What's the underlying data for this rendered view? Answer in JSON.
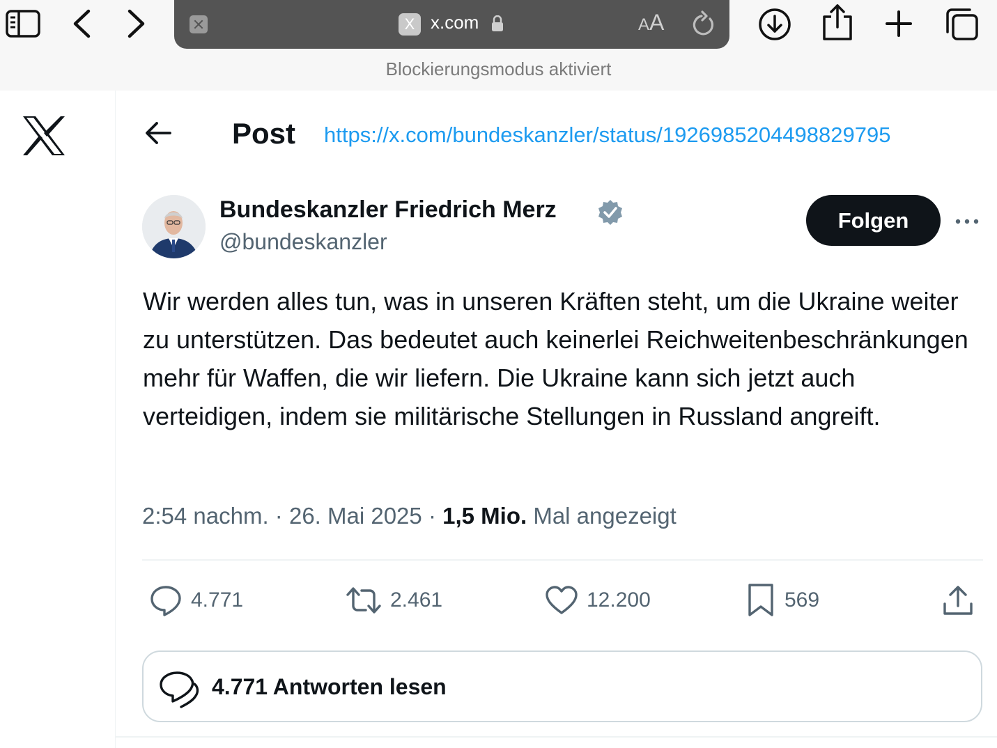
{
  "browser": {
    "domain": "x.com",
    "favicon_letter": "X",
    "text_size_label_small": "A",
    "text_size_label_big": "A",
    "status": "Blockierungsmodus aktiviert"
  },
  "header": {
    "title": "Post",
    "url": "https://x.com/bundeskanzler/status/1926985204498829795"
  },
  "author": {
    "name": "Bundeskanzler Friedrich Merz",
    "handle": "@bundeskanzler",
    "follow_label": "Folgen"
  },
  "post": {
    "text": "Wir werden alles tun, was in unseren Kräften steht, um die Ukraine weiter zu unterstützen. Das bedeutet auch keinerlei Reichweitenbeschränkungen mehr für Waffen, die wir liefern. Die Ukraine kann sich jetzt auch verteidigen, indem sie militärische Stellungen in Russland angreift.",
    "time": "2:54 nachm.",
    "separator": "·",
    "date": "26. Mai 2025",
    "views_count": "1,5 Mio.",
    "views_label": "Mal angezeigt"
  },
  "actions": {
    "replies": "4.771",
    "reposts": "2.461",
    "likes": "12.200",
    "bookmarks": "569"
  },
  "read_replies_label": "4.771 Antworten lesen",
  "colors": {
    "accent": "#1d9bf0",
    "verified": "#829aab",
    "text_primary": "#0f1419",
    "text_secondary": "#536471"
  }
}
